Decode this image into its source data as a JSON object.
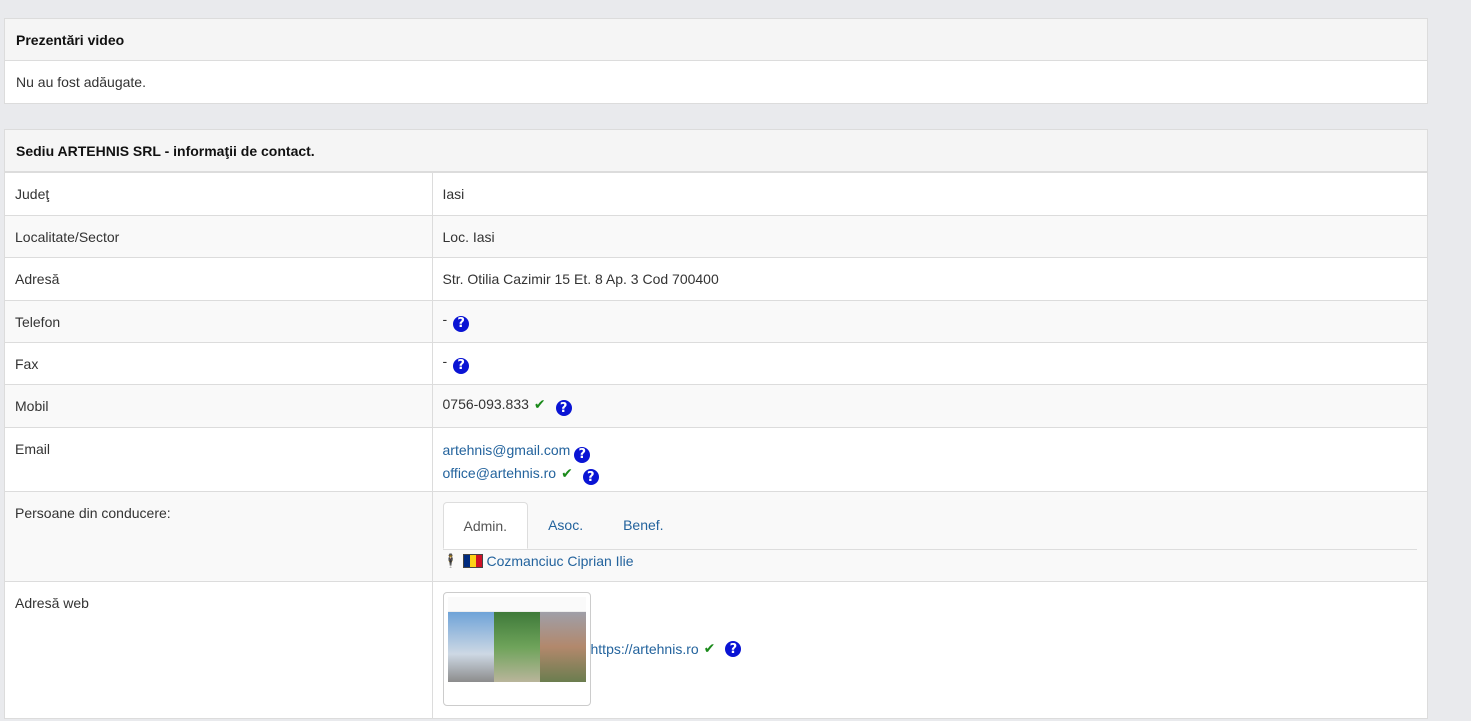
{
  "video": {
    "heading": "Prezentări video",
    "empty_text": "Nu au fost adăugate."
  },
  "contact": {
    "heading": "Sediu ARTEHNIS SRL - informaţii de contact.",
    "judet_label": "Judeţ",
    "judet_value": "Iasi",
    "localitate_label": "Localitate/Sector",
    "localitate_value": "Loc. Iasi",
    "adresa_label": "Adresă",
    "adresa_value": "Str. Otilia Cazimir 15 Et. 8 Ap. 3 Cod 700400",
    "telefon_label": "Telefon",
    "telefon_value": "-",
    "fax_label": "Fax",
    "fax_value": "-",
    "mobil_label": "Mobil",
    "mobil_value": "0756-093.833",
    "email_label": "Email",
    "emails": [
      "artehnis@gmail.com",
      "office@artehnis.ro"
    ],
    "persoane_label": "Persoane din conducere:",
    "tabs": [
      "Admin.",
      "Asoc.",
      "Benef."
    ],
    "active_tab": "Admin.",
    "person_name": "Cozmanciuc Ciprian Ilie",
    "web_label": "Adresă web",
    "web_url": "https://artehnis.ro"
  },
  "icons": {
    "help": "question-circle-icon",
    "verified": "check-icon",
    "person": "person-icon",
    "flag": "romania-flag-icon"
  },
  "colors": {
    "help_icon": "#0a14d4",
    "check_icon": "#1a8a1a",
    "link": "#23639d"
  }
}
